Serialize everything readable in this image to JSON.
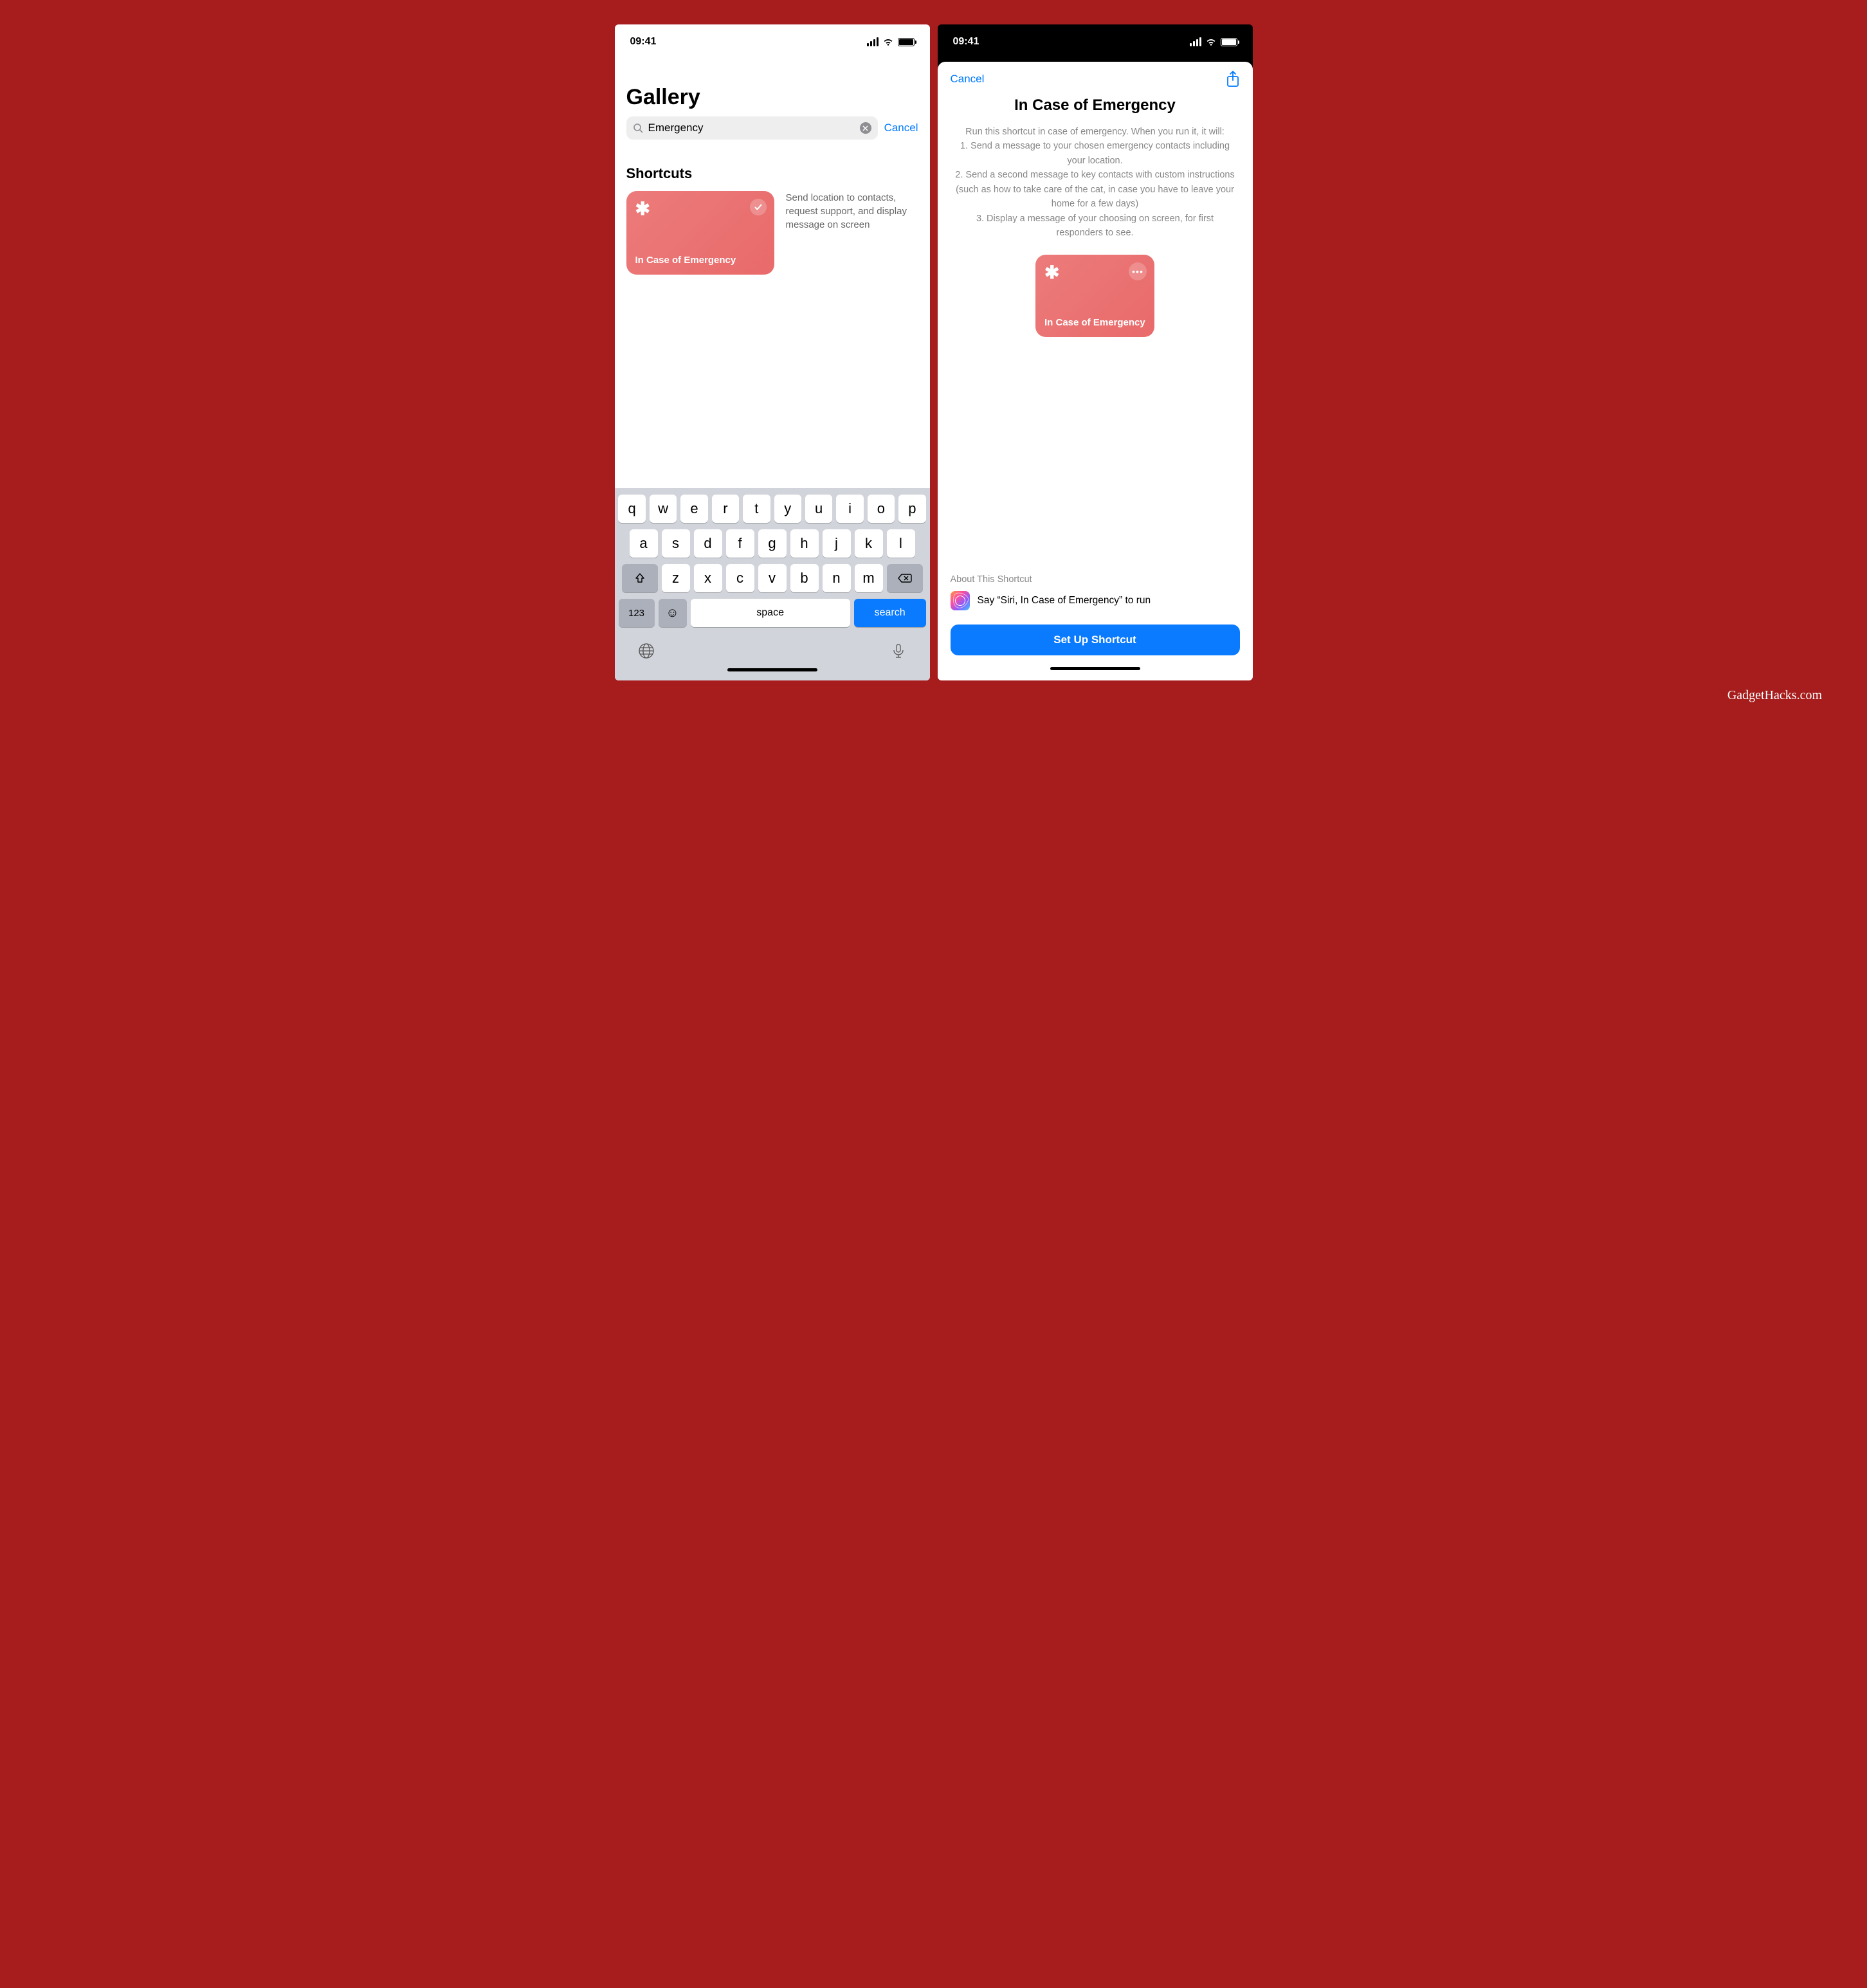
{
  "status": {
    "time": "09:41"
  },
  "left": {
    "title": "Gallery",
    "search": {
      "value": "Emergency",
      "cancel": "Cancel"
    },
    "section": "Shortcuts",
    "tile": {
      "label": "In Case of Emergency"
    },
    "result_desc": "Send location to contacts, request support, and display message on screen"
  },
  "keyboard": {
    "row1": [
      "q",
      "w",
      "e",
      "r",
      "t",
      "y",
      "u",
      "i",
      "o",
      "p"
    ],
    "row2": [
      "a",
      "s",
      "d",
      "f",
      "g",
      "h",
      "j",
      "k",
      "l"
    ],
    "row3": [
      "z",
      "x",
      "c",
      "v",
      "b",
      "n",
      "m"
    ],
    "num": "123",
    "space": "space",
    "search": "search"
  },
  "right": {
    "cancel": "Cancel",
    "title": "In Case of Emergency",
    "desc_intro": "Run this shortcut in case of emergency. When you run it, it will:",
    "desc_1": "1. Send a message to your chosen emergency contacts including your location.",
    "desc_2": "2. Send a second message to key contacts with custom instructions (such as how to take care of the cat, in case you have to leave your home for a few days)",
    "desc_3": "3. Display a message of your choosing on screen, for first responders to see.",
    "tile_label": "In Case of Emergency",
    "about": "About This Shortcut",
    "siri": "Say “Siri, In Case of Emergency” to run",
    "cta": "Set Up Shortcut"
  },
  "watermark": "GadgetHacks.com"
}
